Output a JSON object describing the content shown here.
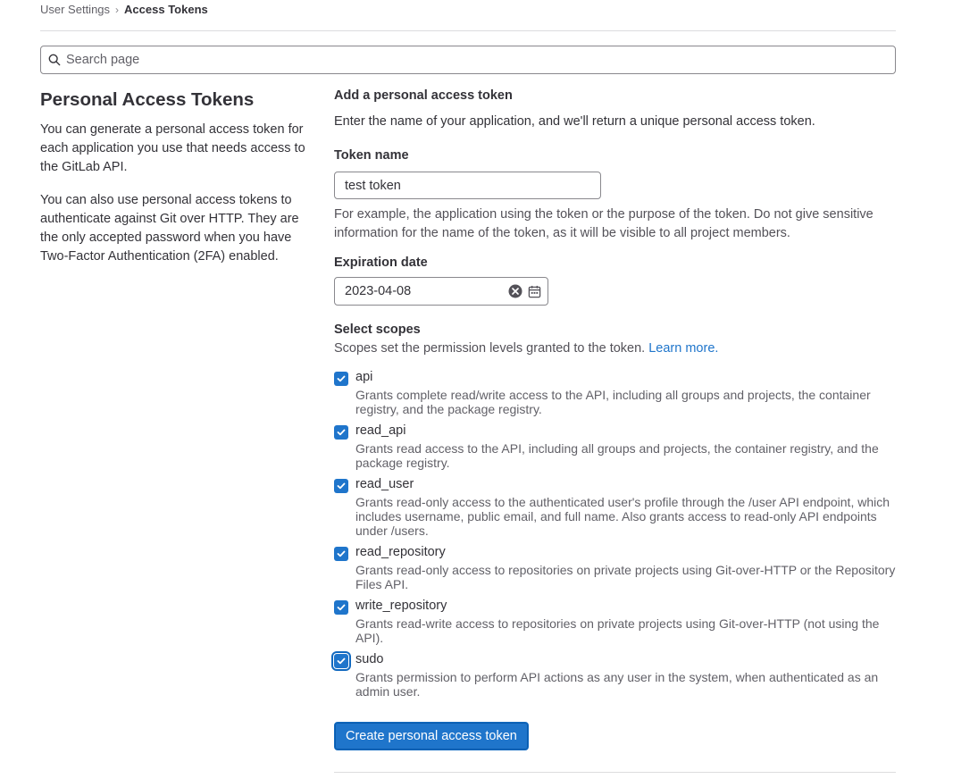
{
  "breadcrumb": {
    "items": [
      "User Settings",
      "Access Tokens"
    ]
  },
  "search": {
    "placeholder": "Search page"
  },
  "left": {
    "title": "Personal Access Tokens",
    "para1": "You can generate a personal access token for each application you use that needs access to the GitLab API.",
    "para2": "You can also use personal access tokens to authenticate against Git over HTTP. They are the only accepted password when you have Two-Factor Authentication (2FA) enabled."
  },
  "form": {
    "heading": "Add a personal access token",
    "intro": "Enter the name of your application, and we'll return a unique personal access token.",
    "token_name_label": "Token name",
    "token_name_value": "test token",
    "token_name_help": "For example, the application using the token or the purpose of the token. Do not give sensitive information for the name of the token, as it will be visible to all project members.",
    "expiration_label": "Expiration date",
    "expiration_value": "2023-04-08",
    "scopes_label": "Select scopes",
    "scopes_help": "Scopes set the permission levels granted to the token.",
    "learn_more": "Learn more.",
    "scopes": [
      {
        "name": "api",
        "checked": true,
        "desc": "Grants complete read/write access to the API, including all groups and projects, the container registry, and the package registry."
      },
      {
        "name": "read_api",
        "checked": true,
        "desc": "Grants read access to the API, including all groups and projects, the container registry, and the package registry."
      },
      {
        "name": "read_user",
        "checked": true,
        "desc": "Grants read-only access to the authenticated user's profile through the /user API endpoint, which includes username, public email, and full name. Also grants access to read-only API endpoints under /users."
      },
      {
        "name": "read_repository",
        "checked": true,
        "desc": "Grants read-only access to repositories on private projects using Git-over-HTTP or the Repository Files API."
      },
      {
        "name": "write_repository",
        "checked": true,
        "desc": "Grants read-write access to repositories on private projects using Git-over-HTTP (not using the API)."
      },
      {
        "name": "sudo",
        "checked": true,
        "desc": "Grants permission to perform API actions as any user in the system, when authenticated as an admin user."
      }
    ],
    "submit_label": "Create personal access token"
  },
  "colors": {
    "accent": "#1f75cb",
    "text": "#333238",
    "muted": "#626168"
  }
}
